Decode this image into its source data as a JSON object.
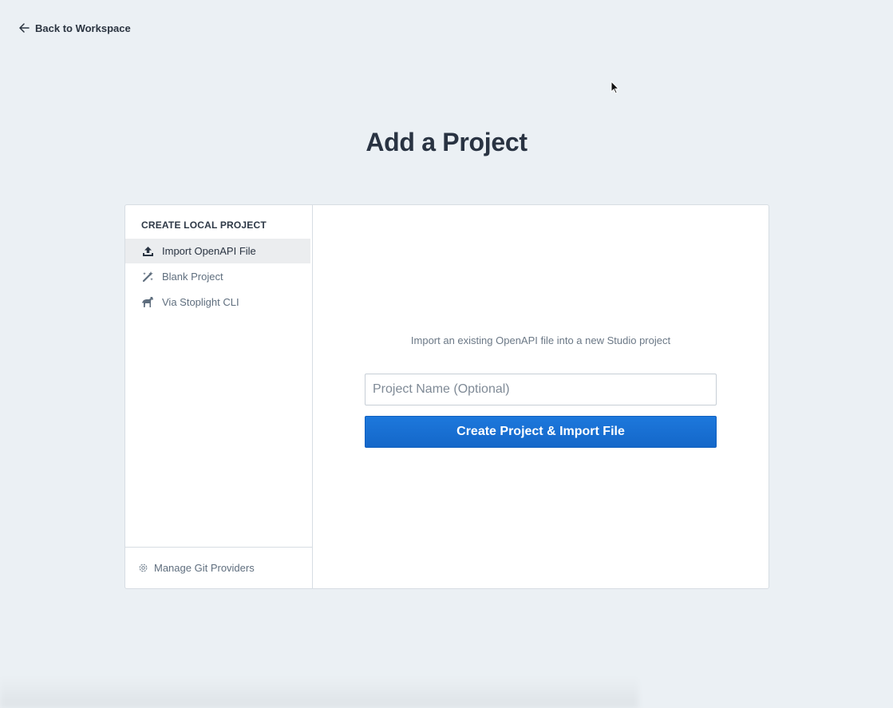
{
  "back_link": {
    "label": "Back to Workspace",
    "icon": "arrow-left-icon"
  },
  "page_title": "Add a Project",
  "sidebar": {
    "heading": "CREATE LOCAL PROJECT",
    "items": [
      {
        "label": "Import OpenAPI File",
        "icon": "upload-icon",
        "active": true
      },
      {
        "label": "Blank Project",
        "icon": "magic-wand-icon",
        "active": false
      },
      {
        "label": "Via Stoplight CLI",
        "icon": "horse-icon",
        "active": false
      }
    ],
    "footer": {
      "label": "Manage Git Providers",
      "icon": "gear-icon"
    }
  },
  "main": {
    "description": "Import an existing OpenAPI file into a new Studio project",
    "project_name_input": {
      "value": "",
      "placeholder": "Project Name (Optional)"
    },
    "submit_button": "Create Project & Import File"
  },
  "colors": {
    "background": "#ebf0f4",
    "primary": "#1a6fd4",
    "active_item_bg": "#ebedef"
  }
}
